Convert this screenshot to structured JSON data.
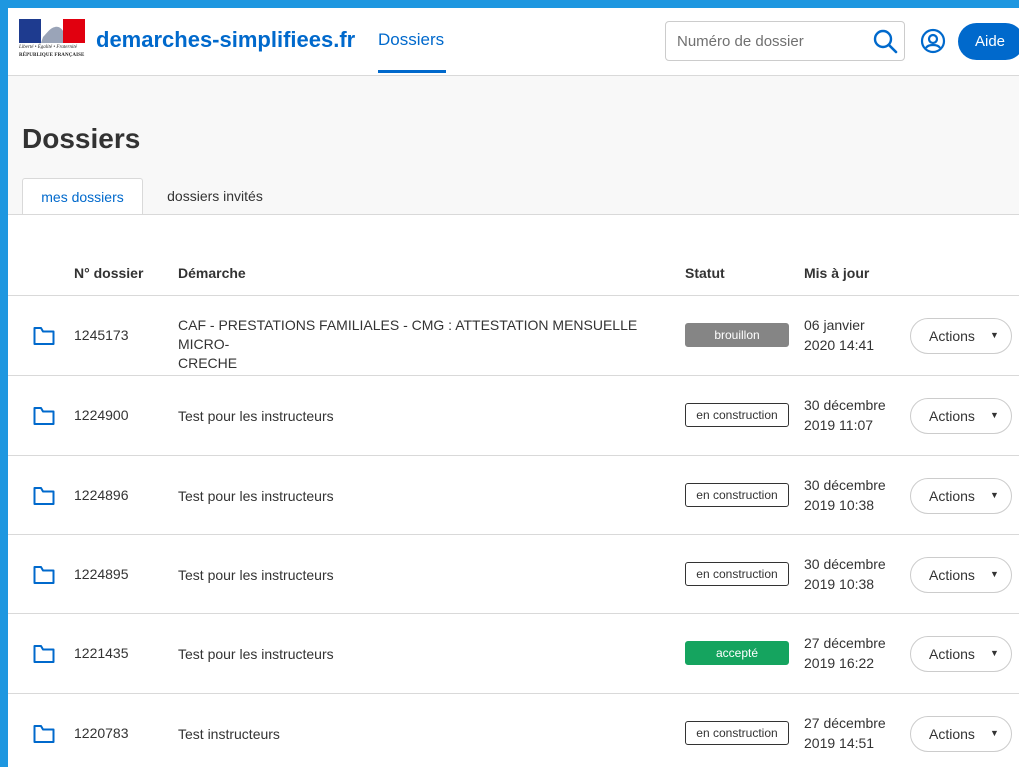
{
  "header": {
    "logo": {
      "motto": "Liberté • Égalité • Fraternité",
      "republic": "RÉPUBLIQUE FRANÇAISE",
      "colors": [
        "#1e3b8f",
        "#ffffff",
        "#e1000f"
      ]
    },
    "site_name": "demarches-simplifiees.fr",
    "nav_link": "Dossiers",
    "search": {
      "placeholder": "Numéro de dossier",
      "value": ""
    },
    "help_label": "Aide"
  },
  "page_title": "Dossiers",
  "tabs": [
    {
      "label": "mes dossiers",
      "active": true
    },
    {
      "label": "dossiers invités",
      "active": false
    }
  ],
  "table": {
    "columns": [
      "N° dossier",
      "Démarche",
      "Statut",
      "Mis à jour"
    ],
    "rows": [
      {
        "number": "1245173",
        "procedure_line1": "CAF - PRESTATIONS FAMILIALES - CMG : ATTESTATION MENSUELLE MICRO-",
        "procedure_line2": "CRECHE",
        "status": "brouillon",
        "status_kind": "draft",
        "date_line1": "06 janvier",
        "date_line2": "2020 14:41",
        "action": "Actions"
      },
      {
        "number": "1224900",
        "procedure_line1": "Test pour les instructeurs",
        "procedure_line2": "",
        "status": "en construction",
        "status_kind": "construct",
        "date_line1": "30 décembre",
        "date_line2": "2019 11:07",
        "action": "Actions"
      },
      {
        "number": "1224896",
        "procedure_line1": "Test pour les instructeurs",
        "procedure_line2": "",
        "status": "en construction",
        "status_kind": "construct",
        "date_line1": "30 décembre",
        "date_line2": "2019 10:38",
        "action": "Actions"
      },
      {
        "number": "1224895",
        "procedure_line1": "Test pour les instructeurs",
        "procedure_line2": "",
        "status": "en construction",
        "status_kind": "construct",
        "date_line1": "30 décembre",
        "date_line2": "2019 10:38",
        "action": "Actions"
      },
      {
        "number": "1221435",
        "procedure_line1": "Test pour les instructeurs",
        "procedure_line2": "",
        "status": "accepté",
        "status_kind": "accepted",
        "date_line1": "27 décembre",
        "date_line2": "2019 16:22",
        "action": "Actions"
      },
      {
        "number": "1220783",
        "procedure_line1": "Test instructeurs",
        "procedure_line2": "",
        "status": "en construction",
        "status_kind": "construct",
        "date_line1": "27 décembre",
        "date_line2": "2019 14:51",
        "action": "Actions"
      }
    ]
  },
  "icons": {
    "search": "search-icon",
    "user": "user-circle-icon",
    "folder": "folder-icon",
    "caret": "caret-down-icon"
  },
  "colors": {
    "brand": "#0069cc",
    "draft": "#858585",
    "accepted": "#15a45f",
    "frame": "#1e97e0"
  }
}
